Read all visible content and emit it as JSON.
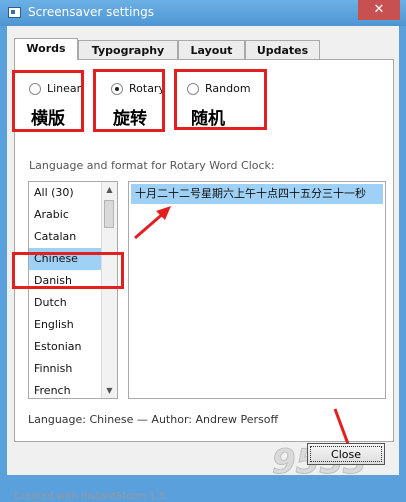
{
  "window": {
    "title": "Screensaver settings",
    "close_glyph": "✕"
  },
  "tabs": [
    {
      "label": "Words",
      "active": true
    },
    {
      "label": "Typography",
      "active": false
    },
    {
      "label": "Layout",
      "active": false
    },
    {
      "label": "Updates",
      "active": false
    }
  ],
  "modes": [
    {
      "label": "Linear",
      "checked": false,
      "chinese": "横版"
    },
    {
      "label": "Rotary",
      "checked": true,
      "chinese": "旋转"
    },
    {
      "label": "Random",
      "checked": false,
      "chinese": "随机"
    }
  ],
  "section_label": "Language and format for Rotary Word Clock:",
  "languages": {
    "items": [
      "All (30)",
      "Arabic",
      "Catalan",
      "Chinese",
      "Danish",
      "Dutch",
      "English",
      "Estonian",
      "Finnish",
      "French"
    ],
    "selected": "Chinese"
  },
  "preview_text": "十月二十二号星期六上午十点四十五分三十一秒",
  "footer_info": "Language: Chinese — Author: Andrew Persoff",
  "created_with": "Created with InstantStorm 1.5",
  "close_button_label": "Close",
  "watermark": "9553",
  "annotation_color": "#e32020"
}
